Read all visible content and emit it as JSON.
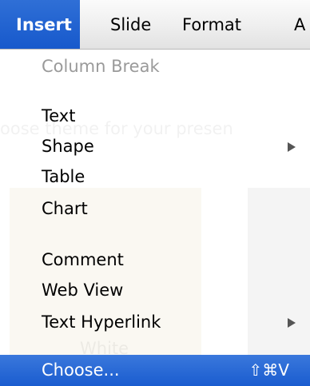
{
  "menubar": {
    "items": [
      {
        "label": "Insert"
      },
      {
        "label": "Slide"
      },
      {
        "label": "Format"
      },
      {
        "label": "A"
      }
    ]
  },
  "insert_menu": {
    "column_break": "Column Break",
    "text": "Text",
    "shape": "Shape",
    "table": "Table",
    "chart": "Chart",
    "comment": "Comment",
    "web_view": "Web View",
    "text_hyperlink": "Text Hyperlink",
    "choose": "Choose...",
    "choose_shortcut": "⇧⌘V"
  },
  "background": {
    "ghost_text": "oose theme for your presen",
    "ghost_label": "White"
  },
  "colors": {
    "highlight": "#1a5ccf",
    "disabled_text": "#9a9a9a"
  }
}
